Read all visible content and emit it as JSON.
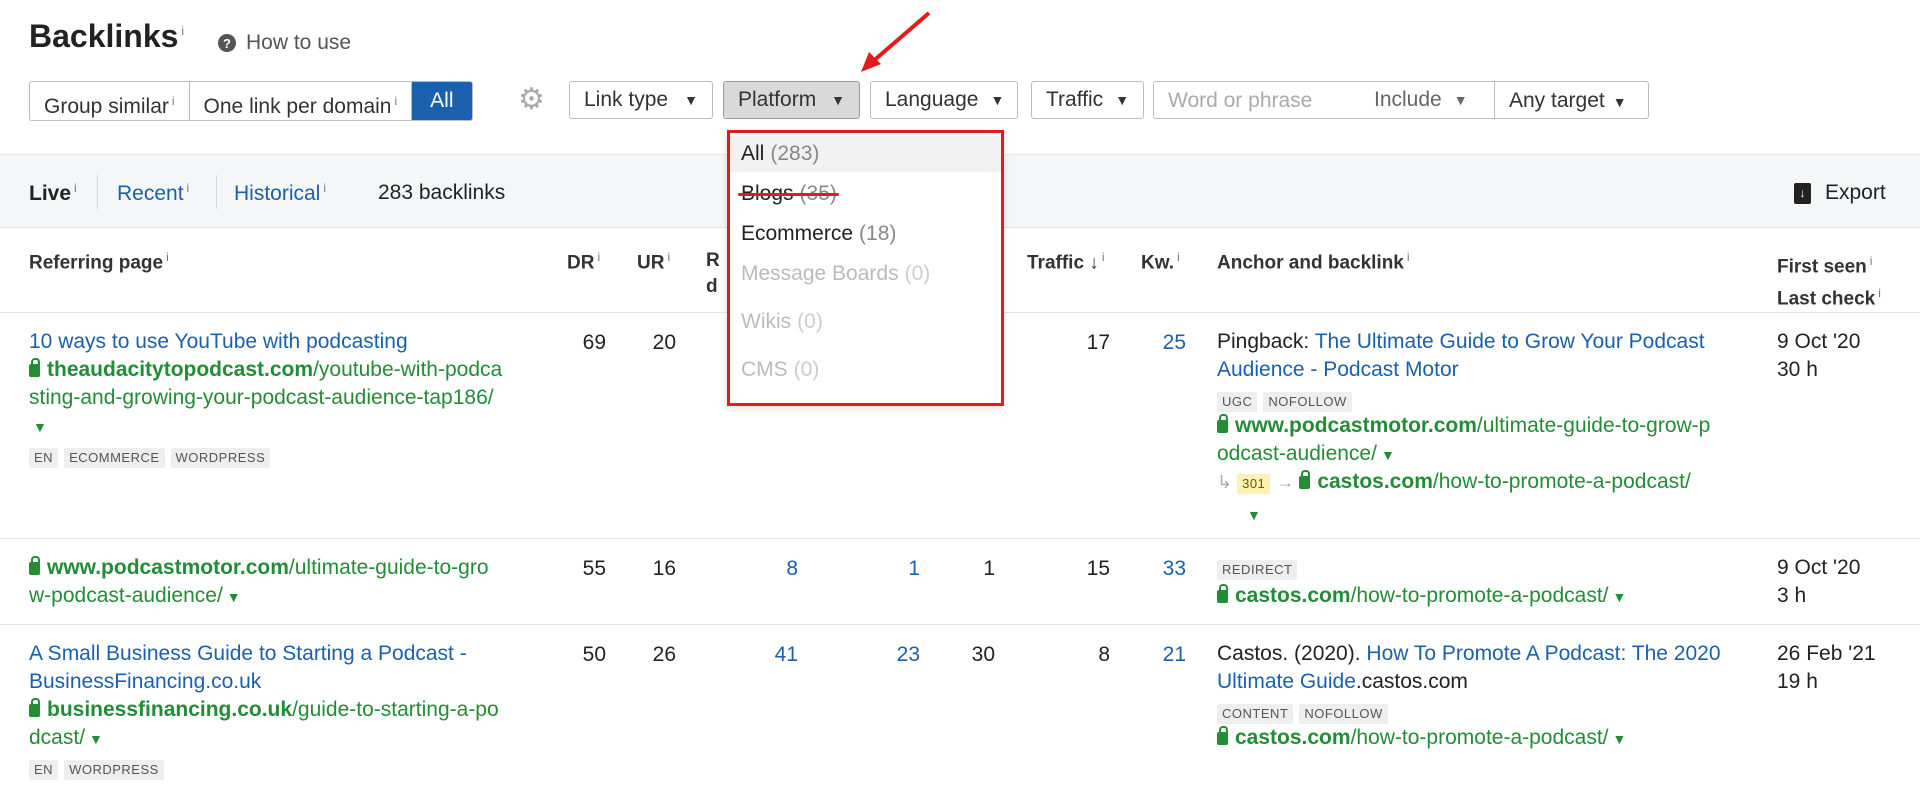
{
  "header": {
    "title": "Backlinks",
    "title_info": "i",
    "howto_icon": "question-circle-icon",
    "howto_label": "How to use"
  },
  "filters": {
    "group_similar": "Group similar",
    "one_link": "One link per domain",
    "all": "All",
    "info": "i",
    "link_type": "Link type",
    "platform": "Platform",
    "language": "Language",
    "traffic": "Traffic",
    "word_placeholder": "Word or phrase",
    "include": "Include",
    "any_target": "Any target"
  },
  "platform_menu": {
    "items": [
      {
        "label": "All",
        "count": "(283)",
        "disabled": false
      },
      {
        "label": "Blogs",
        "count": "(35)",
        "disabled": false
      },
      {
        "label": "Ecommerce",
        "count": "(18)",
        "disabled": false
      },
      {
        "label": "Message Boards",
        "count": "(0)",
        "disabled": true
      },
      {
        "label": "Wikis",
        "count": "(0)",
        "disabled": true
      },
      {
        "label": "CMS",
        "count": "(0)",
        "disabled": true
      }
    ],
    "highlight_color": "#e21b1b"
  },
  "tabs_bar": {
    "live": "Live",
    "recent": "Recent",
    "historical": "Historical",
    "info": "i",
    "count": "283 backlinks",
    "export": "Export"
  },
  "columns": {
    "referring_page": "Referring page",
    "dr": "DR",
    "ur": "UR",
    "rd_partial_1": "R",
    "rd_partial_2": "d",
    "traffic": "Traffic ↓",
    "kw": "Kw.",
    "anchor": "Anchor and backlink",
    "first_seen": "First seen",
    "last_check": "Last check",
    "info": "i"
  },
  "rows": [
    {
      "title": "10 ways to use YouTube with podcasting",
      "domain": "theaudacitytopodcast.com",
      "path1": "/youtube-with-podca",
      "path2": "sting-and-growing-your-podcast-audience-tap186/",
      "tags": [
        "EN",
        "ECOMMERCE",
        "WORDPRESS"
      ],
      "dr": "69",
      "ur": "20",
      "traffic": "17",
      "kw": "25",
      "anchor_prefix": "Pingback: ",
      "anchor_text1": "The Ultimate Guide to Grow Your Podcast",
      "anchor_text2": "Audience - Podcast Motor",
      "anchor_tags": [
        "UGC",
        "NOFOLLOW"
      ],
      "target_domain": "www.podcastmotor.com",
      "target_path1": "/ultimate-guide-to-grow-p",
      "target_path2": "odcast-audience/",
      "redirect_code": "301",
      "redirect_domain": "castos.com",
      "redirect_path": "/how-to-promote-a-podcast/",
      "first_seen": "9 Oct '20",
      "last_check": "30 h"
    },
    {
      "domain": "www.podcastmotor.com",
      "path1": "/ultimate-guide-to-gro",
      "path2": "w-podcast-audience/",
      "dr": "55",
      "ur": "16",
      "rd": "8",
      "ld": "1",
      "col5": "1",
      "traffic": "15",
      "kw": "33",
      "anchor_tags": [
        "REDIRECT"
      ],
      "target_domain": "castos.com",
      "target_path1": "/how-to-promote-a-podcast/",
      "first_seen": "9 Oct '20",
      "last_check": "3 h"
    },
    {
      "title1": "A Small Business Guide to Starting a Podcast -",
      "title2": "BusinessFinancing.co.uk",
      "domain": "businessfinancing.co.uk",
      "path1": "/guide-to-starting-a-po",
      "path2": "dcast/",
      "tags": [
        "EN",
        "WORDPRESS"
      ],
      "dr": "50",
      "ur": "26",
      "rd": "41",
      "ld": "23",
      "col5": "30",
      "traffic": "8",
      "kw": "21",
      "anchor_prefix": "Castos. (2020). ",
      "anchor_text1": "How To Promote A Podcast: The 2020",
      "anchor_text2": "Ultimate Guide",
      "anchor_suffix": ".castos.com",
      "anchor_tags": [
        "CONTENT",
        "NOFOLLOW"
      ],
      "target_domain": "castos.com",
      "target_path1": "/how-to-promote-a-podcast/",
      "first_seen": "26 Feb '21",
      "last_check": "19 h"
    }
  ]
}
